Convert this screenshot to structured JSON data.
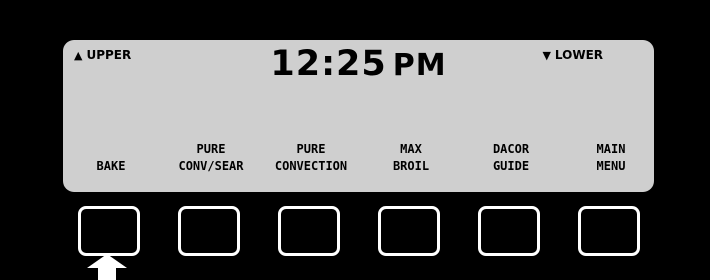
{
  "display": {
    "upper_label": "UPPER",
    "lower_label": "LOWER",
    "upper_icon": "triangle-up",
    "lower_icon": "triangle-down",
    "time": "12:25",
    "ampm": "PM"
  },
  "soft_keys": [
    {
      "line1": "",
      "line2": "BAKE"
    },
    {
      "line1": "PURE",
      "line2": "CONV/SEAR"
    },
    {
      "line1": "PURE",
      "line2": "CONVECTION"
    },
    {
      "line1": "MAX",
      "line2": "BROIL"
    },
    {
      "line1": "DACOR",
      "line2": "GUIDE"
    },
    {
      "line1": "MAIN",
      "line2": "MENU"
    }
  ],
  "pointer": {
    "icon": "up-arrow-icon",
    "points_to": "BAKE"
  },
  "colors": {
    "panel": "#000000",
    "lcd": "#cfcfcf",
    "text": "#000000",
    "button_outline": "#ffffff"
  }
}
